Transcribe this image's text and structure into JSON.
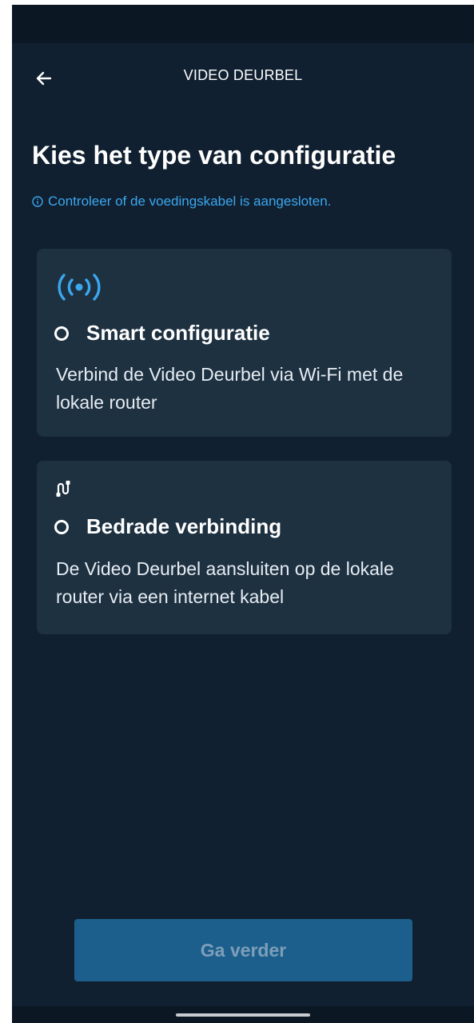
{
  "app_bar": {
    "title": "VIDEO DEURBEL",
    "back_icon": "arrow-left-icon"
  },
  "page": {
    "title": "Kies het type van configuratie",
    "hint": "Controleer of de voedingskabel is aangesloten.",
    "hint_icon": "info-icon"
  },
  "options": [
    {
      "icon": "wireless-signal-icon",
      "title": "Smart configuratie",
      "description": "Verbind de Video Deurbel via Wi-Fi met de lokale router",
      "selected": false
    },
    {
      "icon": "ethernet-cable-icon",
      "title": "Bedrade verbinding",
      "description": "De Video Deurbel aansluiten op de lokale router via een internet kabel",
      "selected": false
    }
  ],
  "footer": {
    "continue_label": "Ga verder",
    "continue_enabled": false
  },
  "colors": {
    "background": "#102030",
    "card": "#1e3141",
    "accent": "#3ba7ee",
    "button_disabled": "#1d5f8c",
    "button_text_disabled": "#7d9fb9"
  }
}
